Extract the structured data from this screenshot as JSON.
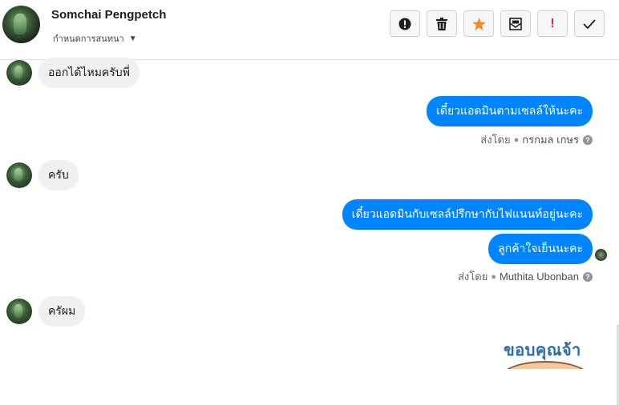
{
  "header": {
    "contact_name": "Somchai Pengpetch",
    "manage_label": "กำหนดการสนทนา",
    "toolbar": {
      "buttons": [
        {
          "name": "mark-spam",
          "icon": "exclamation-circle-icon"
        },
        {
          "name": "delete",
          "icon": "trash-icon"
        },
        {
          "name": "star",
          "icon": "star-icon"
        },
        {
          "name": "mark-unread",
          "icon": "envelope-icon"
        },
        {
          "name": "follow-up",
          "icon": "exclamation-icon"
        },
        {
          "name": "done",
          "icon": "check-icon"
        }
      ],
      "star_color": "#f08c2b",
      "urgent_color": "#e41e3f"
    }
  },
  "messages": [
    {
      "direction": "in",
      "text": "ออกได้ไหมครับพี่"
    },
    {
      "direction": "out",
      "text": "เดี๋ยวแอดมินตามเซลล์ให้นะคะ"
    },
    {
      "sent_by_label": "ส่งโดย",
      "sender": "กรกมล เกษร"
    },
    {
      "direction": "in",
      "text": "ครับ"
    },
    {
      "direction": "out",
      "text": "เดี๋ยวแอดมินกับเซลล์ปรึกษากับไฟแนนท์อยู่นะคะ"
    },
    {
      "direction": "out",
      "text": "ลูกค้าใจเย็นนะคะ"
    },
    {
      "sent_by_label": "ส่งโดย",
      "sender": "Muthita Ubonban"
    },
    {
      "direction": "in",
      "text": "ครัผม"
    }
  ],
  "sticker": {
    "text": "ขอบคุณจ้า"
  },
  "colors": {
    "outgoing_bubble": "#0084ff",
    "incoming_bubble": "#f0f0f0"
  }
}
